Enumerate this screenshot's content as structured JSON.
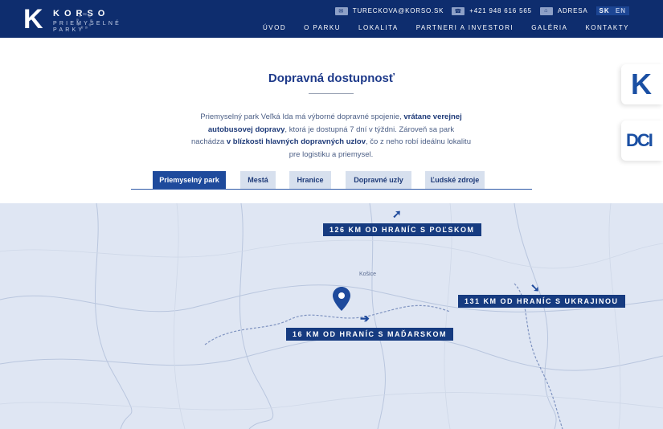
{
  "brand": {
    "logo_letter": "K",
    "name": "KORSO",
    "subtitle": "PRIEMYSELNÉ PARKY"
  },
  "header": {
    "email": "TURECKOVA@KORSO.SK",
    "phone": "+421 948 616 565",
    "address": "ADRESA",
    "lang_active": "SK",
    "lang_other": "EN"
  },
  "nav": [
    "ÚVOD",
    "O PARKU",
    "LOKALITA",
    "PARTNERI A INVESTORI",
    "GALÉRIA",
    "KONTAKTY"
  ],
  "side_badges": [
    "K",
    "DCI"
  ],
  "section": {
    "title": "Dopravná dostupnosť",
    "intro_1": "Priemyselný park Veľká Ida má výborné dopravné spojenie, ",
    "intro_b1": "vrátane verejnej autobusovej dopravy",
    "intro_2": ", ktorá je dostupná 7 dní v týždni. Zároveň sa park nachádza ",
    "intro_b2": "v blízkosti hlavných dopravných uzlov",
    "intro_3": ", čo z neho robí ideálnu lokalitu pre logistiku a priemysel."
  },
  "tabs": [
    {
      "label": "Priemyselný park",
      "active": true
    },
    {
      "label": "Mestá",
      "active": false
    },
    {
      "label": "Hranice",
      "active": false
    },
    {
      "label": "Dopravné uzly",
      "active": false
    },
    {
      "label": "Ľudské zdroje",
      "active": false
    }
  ],
  "map": {
    "city": "Košice",
    "labels": {
      "poland": "126 KM OD HRANÍC S POĽSKOM",
      "ukraine": "131 KM OD HRANÍC S UKRAJINOU",
      "hungary": "16 KM OD HRANÍC S MAĎARSKOM"
    }
  },
  "colors": {
    "header_bg": "#0e2d6e",
    "accent": "#1e4a9c",
    "map_bg": "#dfe6f3"
  }
}
